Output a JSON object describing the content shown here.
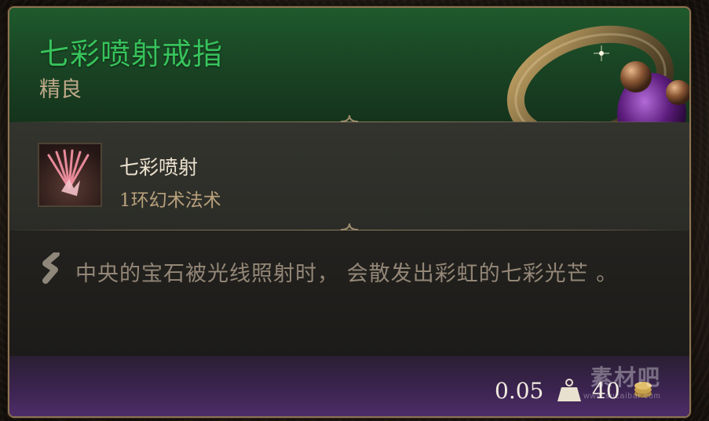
{
  "item": {
    "name": "七彩喷射戒指",
    "rarity": "精良",
    "rarity_color": "#37c25b"
  },
  "spell": {
    "icon": "prismatic-spray-icon",
    "name": "七彩喷射",
    "subtitle": "1环幻术法术"
  },
  "description": {
    "icon": "quote-icon",
    "text": "中央的宝石被光线照射时， 会散发出彩虹的七彩光芒 。"
  },
  "footer": {
    "weight": "0.05",
    "weight_icon": "weight-icon",
    "value": "40",
    "value_icon": "gold-coin-icon"
  },
  "watermark": {
    "text": "素材吧",
    "url": "www.sucaibar.com"
  }
}
